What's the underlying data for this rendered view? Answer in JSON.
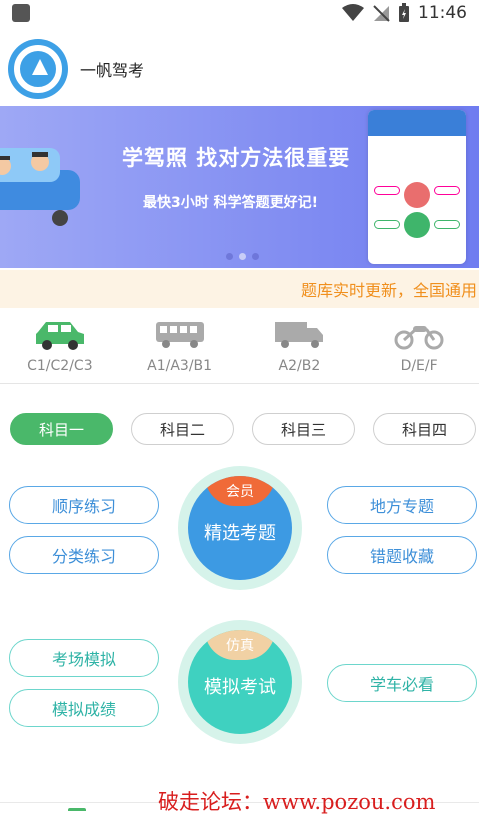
{
  "status_bar": {
    "time": "11:46"
  },
  "header": {
    "app_name": "一帆驾考"
  },
  "banner": {
    "title": "学驾照  找对方法很重要",
    "subtitle": "最快3小时  科学答题更好记!"
  },
  "notice": {
    "text": "题库实时更新，全国通用"
  },
  "license_types": [
    {
      "label": "C1/C2/C3",
      "icon": "car-icon"
    },
    {
      "label": "A1/A3/B1",
      "icon": "bus-icon"
    },
    {
      "label": "A2/B2",
      "icon": "truck-icon"
    },
    {
      "label": "D/E/F",
      "icon": "motorcycle-icon"
    }
  ],
  "subjects": [
    {
      "label": "科目一",
      "active": true
    },
    {
      "label": "科目二",
      "active": false
    },
    {
      "label": "科目三",
      "active": false
    },
    {
      "label": "科目四",
      "active": false
    }
  ],
  "practice": {
    "sequential": "顺序练习",
    "category": "分类练习",
    "regional": "地方专题",
    "wrong_collect": "错题收藏",
    "center_title": "精选考题",
    "center_badge": "会员"
  },
  "exam": {
    "venue_sim": "考场模拟",
    "sim_score": "模拟成绩",
    "must_see": "学车必看",
    "center_title": "模拟考试",
    "center_badge": "仿真"
  },
  "colors": {
    "green": "#4ab86a",
    "blue": "#3d8fd8",
    "teal": "#2fb3a6",
    "orange": "#f08f1d"
  },
  "watermark": "破走论坛：www.pozou.com"
}
